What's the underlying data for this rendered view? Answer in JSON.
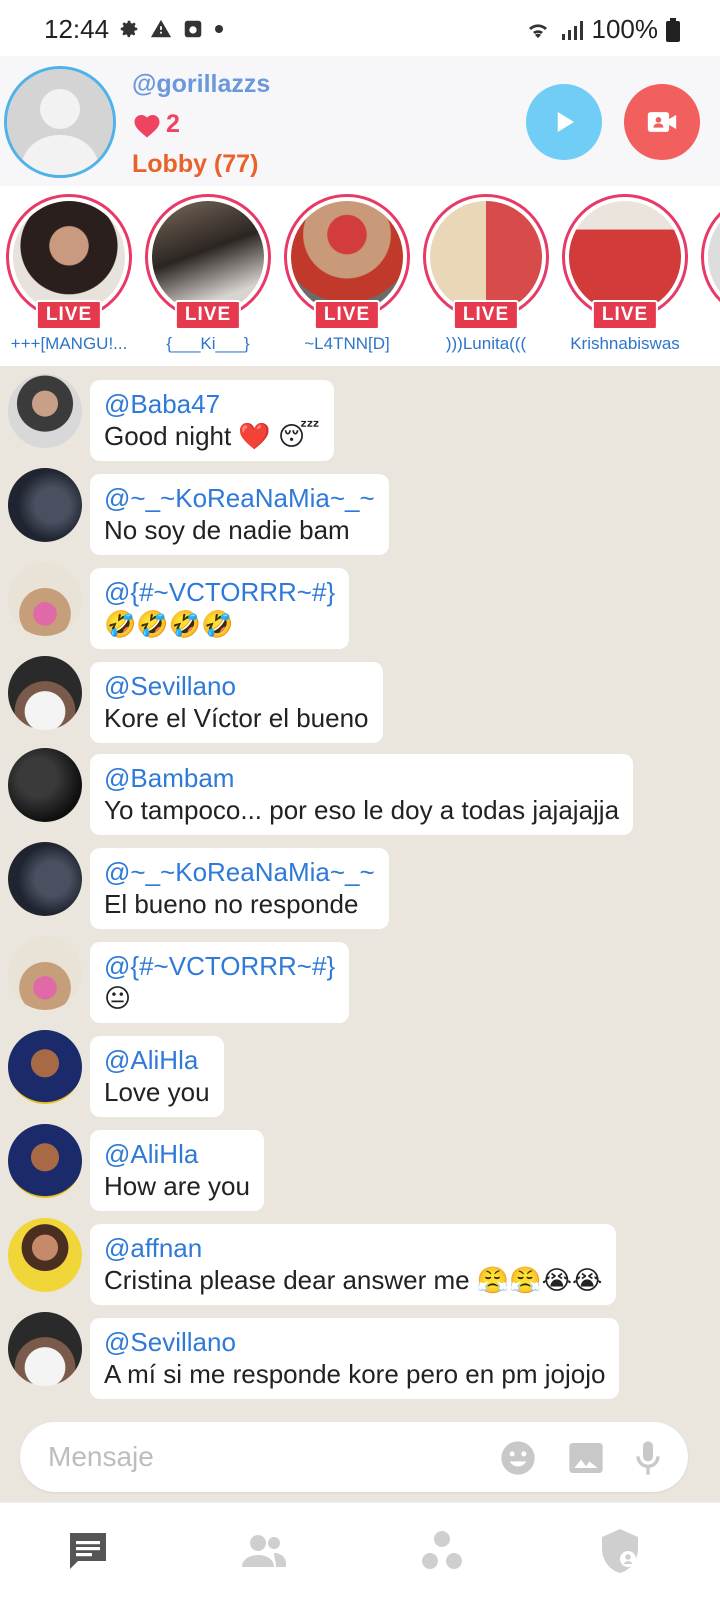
{
  "status_bar": {
    "time": "12:44",
    "battery": "100%"
  },
  "profile": {
    "username": "@gorillazzs",
    "likes": "2",
    "lobby": "Lobby (77)"
  },
  "stories": [
    {
      "name": "+++[MANGU!...",
      "badge": "LIVE"
    },
    {
      "name": "{___Ki___}",
      "badge": "LIVE"
    },
    {
      "name": "~L4TNN[D]",
      "badge": "LIVE"
    },
    {
      "name": ")))Lunita(((",
      "badge": "LIVE"
    },
    {
      "name": "Krishnabiswas",
      "badge": "LIVE"
    }
  ],
  "messages": [
    {
      "handle": "@Baba47",
      "text": "Good night ❤️ 😴"
    },
    {
      "handle": "@~_~KoReaNaMia~_~",
      "text": "No soy de nadie bam"
    },
    {
      "handle": "@{#~VCTORRR~#}",
      "text": "🤣🤣🤣🤣"
    },
    {
      "handle": "@Sevillano",
      "text": "Kore el Víctor el bueno"
    },
    {
      "handle": "@Bambam",
      "text": "Yo tampoco... por eso le doy a todas jajajajja"
    },
    {
      "handle": "@~_~KoReaNaMia~_~",
      "text": "El bueno no responde"
    },
    {
      "handle": "@{#~VCTORRR~#}",
      "text": "😐"
    },
    {
      "handle": "@AliHla",
      "text": "Love you"
    },
    {
      "handle": "@AliHla",
      "text": "How are you"
    },
    {
      "handle": "@affnan",
      "text": "Cristina please dear answer me 😤😤😭😭"
    },
    {
      "handle": "@Sevillano",
      "text": "A mí si me responde kore pero en pm jojojo"
    }
  ],
  "input": {
    "placeholder": "Mensaje"
  },
  "colors": {
    "accent_blue": "#2f7ad8",
    "live_red": "#e53a4e",
    "heart_pink": "#ee4462",
    "lobby_orange": "#e8622a"
  }
}
